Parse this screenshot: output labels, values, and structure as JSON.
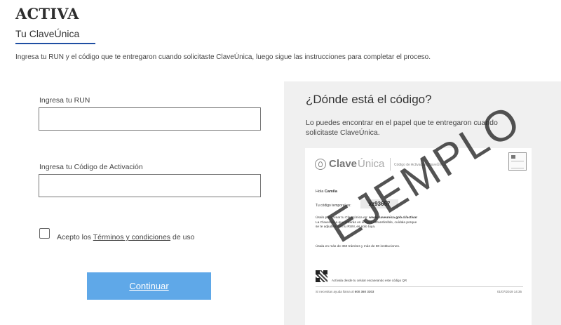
{
  "header": {
    "title": "ACTIVA",
    "subtitle": "Tu ClaveÚnica",
    "instructions": "Ingresa tu RUN y el código que te entregaron cuando solicitaste ClaveÚnica, luego sigue las instrucciones para completar el proceso."
  },
  "form": {
    "run_label": "Ingresa tu RUN",
    "run_value": "",
    "code_label": "Ingresa tu Código de Activación",
    "code_value": "",
    "terms_prefix": "Acepto los",
    "terms_link": "Términos y condiciones",
    "terms_suffix": "de uso",
    "terms_checked": false,
    "continue_label": "Continuar"
  },
  "help": {
    "title": "¿Dónde está el código?",
    "text": "Lo puedes encontrar en el papel que te entregaron cuando solicitaste ClaveÚnica.",
    "example_document": {
      "logo_clave": "Clave",
      "logo_unica": "Única",
      "logo_caption": "Código de Activación ClaveÚnica",
      "greeting_prefix": "Hola",
      "greeting_name": "Camila",
      "code_label": "Tu código temporal es:",
      "code_value": "xz93657",
      "para1_prefix": "Úsalo para crear tu ClaveÚnica en:",
      "para1_link": "www.claveunica.gob.cl/activar",
      "para1_line2": "La ClaveÚnica que crearás es única e intransferible, cuídala porque",
      "para1_line3": "se te adjudica con tu RUN, es solo tuya.",
      "para2": "Úsala en más de 360 trámites y más de 80 instituciones.",
      "qr_text": "Actívala desde tu celular escaneando este código QR",
      "footer_left_prefix": "Si necesitas ayuda llama al",
      "footer_phone": "600 360 3303",
      "footer_right": "01/07/2019 14:35"
    },
    "watermark": "EJEMPLO"
  },
  "colors": {
    "accent_underline": "#1f4fa3",
    "button_bg": "#5fa8e8",
    "panel_bg": "#f0f0f0"
  }
}
